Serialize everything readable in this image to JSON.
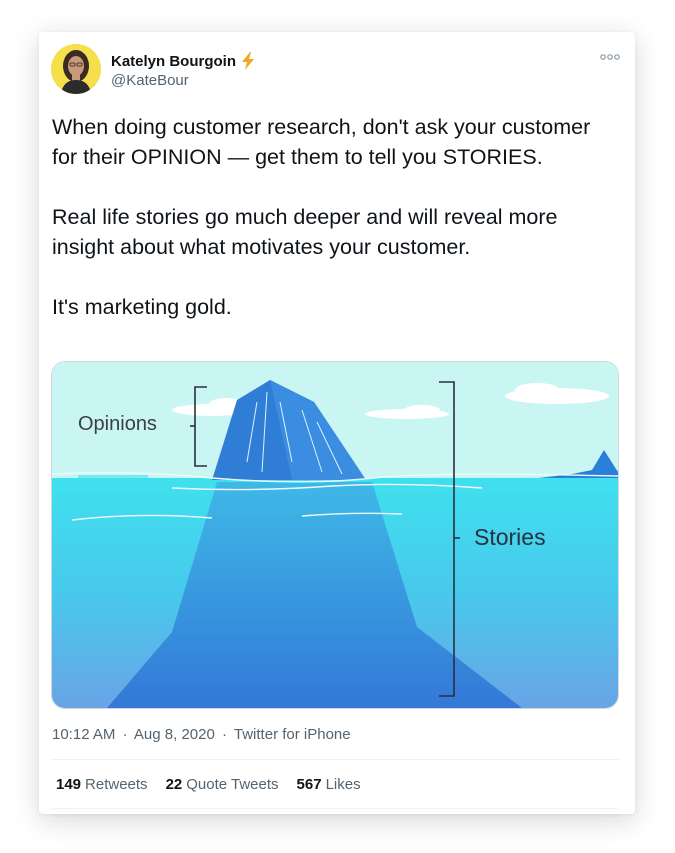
{
  "author": {
    "name": "Katelyn Bourgoin",
    "handle": "@KateBour",
    "badge_icon": "lightning-bolt-icon",
    "badge_color": "#f4a623"
  },
  "tweet": {
    "paragraphs": [
      "When doing customer research, don't ask your customer for their OPINION — get them to tell you STORIES.",
      "Real life stories go much deeper and will reveal more insight about what motivates your customer.",
      "It's marketing gold."
    ]
  },
  "image": {
    "opinions_label": "Opinions",
    "stories_label": "Stories"
  },
  "meta": {
    "time": "10:12 AM",
    "sep1": "·",
    "date": "Aug 8, 2020",
    "sep2": "·",
    "source": "Twitter for iPhone"
  },
  "stats": {
    "retweets_count": "149",
    "retweets_label": "Retweets",
    "quotes_count": "22",
    "quotes_label": "Quote Tweets",
    "likes_count": "567",
    "likes_label": "Likes"
  },
  "colors": {
    "text": "#0f1419",
    "secondary": "#536471",
    "sky": "#c9f6f3",
    "water": "#4fd9ea",
    "ice": "#2f7fd6"
  }
}
